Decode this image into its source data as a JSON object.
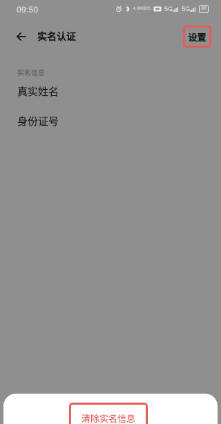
{
  "status_bar": {
    "time": "09:50",
    "icons": [
      "alarm-icon",
      "bluetooth-icon",
      "network-speed-icon",
      "hd-icon",
      "signal-icon",
      "battery-icon"
    ],
    "speed_top": "4.00",
    "speed_bottom": "KB/S",
    "signal_1": "5G",
    "signal_2": "5G",
    "battery": "86"
  },
  "header": {
    "title": "实名认证",
    "settings_label": "设置"
  },
  "content": {
    "section_label": "实名信息",
    "field_real_name": "真实姓名",
    "field_id_number": "身份证号"
  },
  "bottom_sheet": {
    "clear_label": "清除实名信息"
  },
  "colors": {
    "overlay": "#8f8f8f",
    "accent": "#e75a5a",
    "sheet": "#ffffff"
  }
}
